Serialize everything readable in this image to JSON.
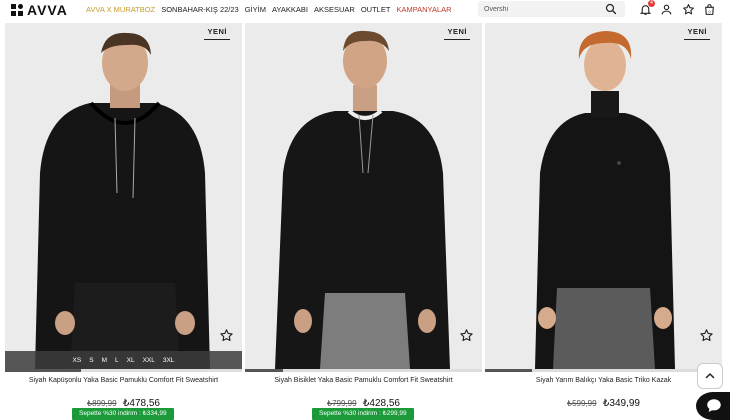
{
  "header": {
    "logo_text": "AVVA",
    "nav": [
      {
        "label": "AVVA X MURATBOZ",
        "style": "gold"
      },
      {
        "label": "SONBAHAR-KIŞ 22/23",
        "style": "normal"
      },
      {
        "label": "GİYİM",
        "style": "normal"
      },
      {
        "label": "AYAKKABI",
        "style": "normal"
      },
      {
        "label": "AKSESUAR",
        "style": "normal"
      },
      {
        "label": "OUTLET",
        "style": "normal"
      },
      {
        "label": "KAMPANYALAR",
        "style": "red"
      }
    ],
    "search_placeholder": "Overshi",
    "notification_count": "4",
    "icons": [
      "search-icon",
      "bell-icon",
      "user-icon",
      "star-icon",
      "bag-icon"
    ]
  },
  "products": [
    {
      "badge": "YENİ",
      "title": "Siyah Kapüşonlu Yaka Basic Pamuklu Comfort Fit Sweatshirt",
      "old_price": "₺899,99",
      "new_price": "₺478,56",
      "promo": "Sepette %30 indirim : ₺334,99",
      "sizes": [
        "XS",
        "S",
        "M",
        "L",
        "XL",
        "XXL",
        "3XL"
      ],
      "progress": 0.32
    },
    {
      "badge": "YENİ",
      "title": "Siyah Bisiklet Yaka Basic Pamuklu Comfort Fit Sweatshirt",
      "old_price": "₺799,99",
      "new_price": "₺428,56",
      "promo": "Sepette %30 indirim : ₺299,99",
      "progress": 0.16
    },
    {
      "badge": "YENİ",
      "title": "Siyah Yarım Balıkçı Yaka Basic Triko Kazak",
      "old_price": "₺599,99",
      "new_price": "₺349,99",
      "progress": 0.2
    }
  ],
  "colors": {
    "gold": "#c59a2a",
    "red": "#c0392b",
    "promo_green": "#1c9a3a",
    "badge_red": "#e53935"
  }
}
